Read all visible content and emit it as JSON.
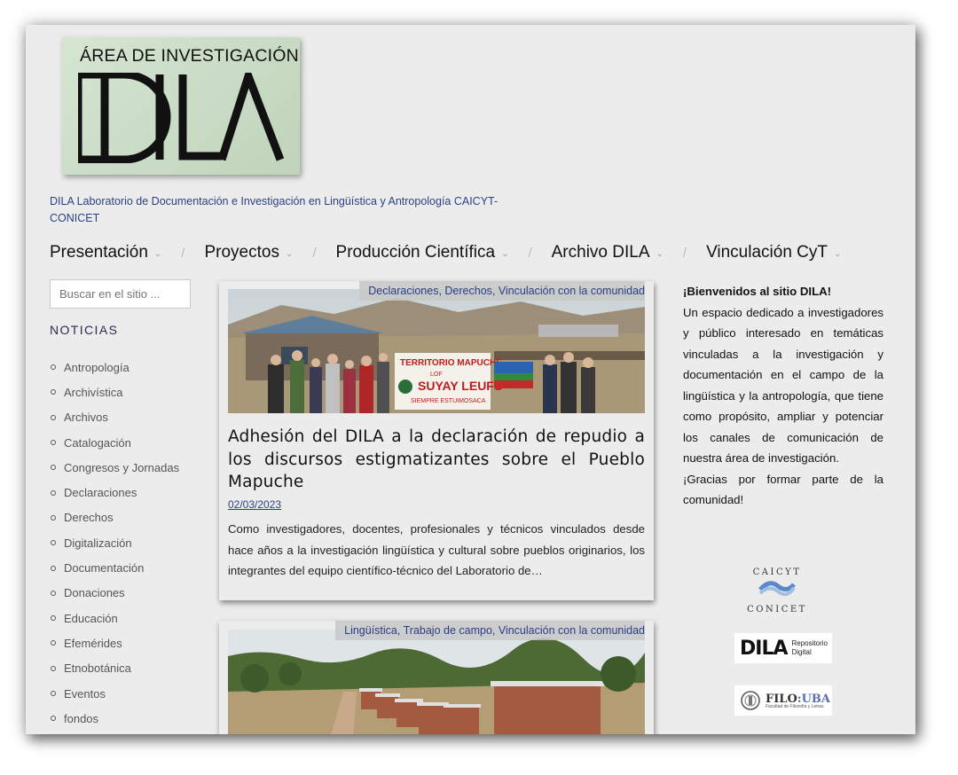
{
  "header": {
    "logo_top_text": "ÁREA DE INVESTIGACIÓN",
    "logo_main_text": "DILA",
    "tagline": "DILA Laboratorio de Documentación e Investigación en Lingüística y Antropología CAICYT-CONICET"
  },
  "nav": {
    "items": [
      {
        "label": "Presentación"
      },
      {
        "label": "Proyectos"
      },
      {
        "label": "Producción Científica"
      },
      {
        "label": "Archivo DILA"
      },
      {
        "label": "Vinculación CyT"
      }
    ],
    "separator": "/"
  },
  "sidebar": {
    "search_placeholder": "Buscar en el sitio ...",
    "news_heading": "NOTICIAS",
    "categories": [
      "Antropología",
      "Archivística",
      "Archivos",
      "Catalogación",
      "Congresos y Jornadas",
      "Declaraciones",
      "Derechos",
      "Digitalización",
      "Documentación",
      "Donaciones",
      "Educación",
      "Efemérides",
      "Etnobotánica",
      "Eventos",
      "fondos"
    ]
  },
  "posts": [
    {
      "categories": "Declaraciones, Derechos, Vinculación con la comunidad",
      "title": "Adhesión del DILA a la declaración de repudio a los discursos estigmatizantes sobre el Pueblo Mapuche",
      "date": "02/03/2023",
      "excerpt": "Como investigadores, docentes, profesionales y técnicos vinculados desde hace años a la investigación lingüística y cultural sobre pueblos originarios, los integrantes del equipo científico-técnico del Laboratorio de…",
      "banner_text": {
        "line1": "TERRITORIO MAPUCHE",
        "line2": "LOF",
        "line3": "SUYAY LEUFU",
        "line4": "SIEMPRE ESTUIMOSACA"
      }
    },
    {
      "categories": "Lingüística, Trabajo de campo, Vinculación con la comunidad"
    }
  ],
  "right_sidebar": {
    "welcome_heading": "¡Bienvenidos al sitio DILA!",
    "welcome_body": "Un espacio dedicado a investigadores y público interesado en temáticas vinculadas a la investigación y documentación en el campo de la lingüística y la antropología, que tiene como propósito, ampliar y potenciar los canales de comunicación de nuestra área de investigación.",
    "welcome_thanks": "¡Gracias por formar parte de la comunidad!",
    "partners": {
      "caicyt_top": "CAICYT",
      "caicyt_bottom": "CONICET",
      "repo_logo": "DILA",
      "repo_line1": "Repositorio",
      "repo_line2": "Digital",
      "filo_name_a": "FILO",
      "filo_name_b": ":UBA",
      "filo_sub": "Facultad de Filosofía y Letras"
    }
  },
  "colors": {
    "link": "#2b3f86",
    "page_bg": "#ececec",
    "logo_bg": "#c9dcc5"
  }
}
